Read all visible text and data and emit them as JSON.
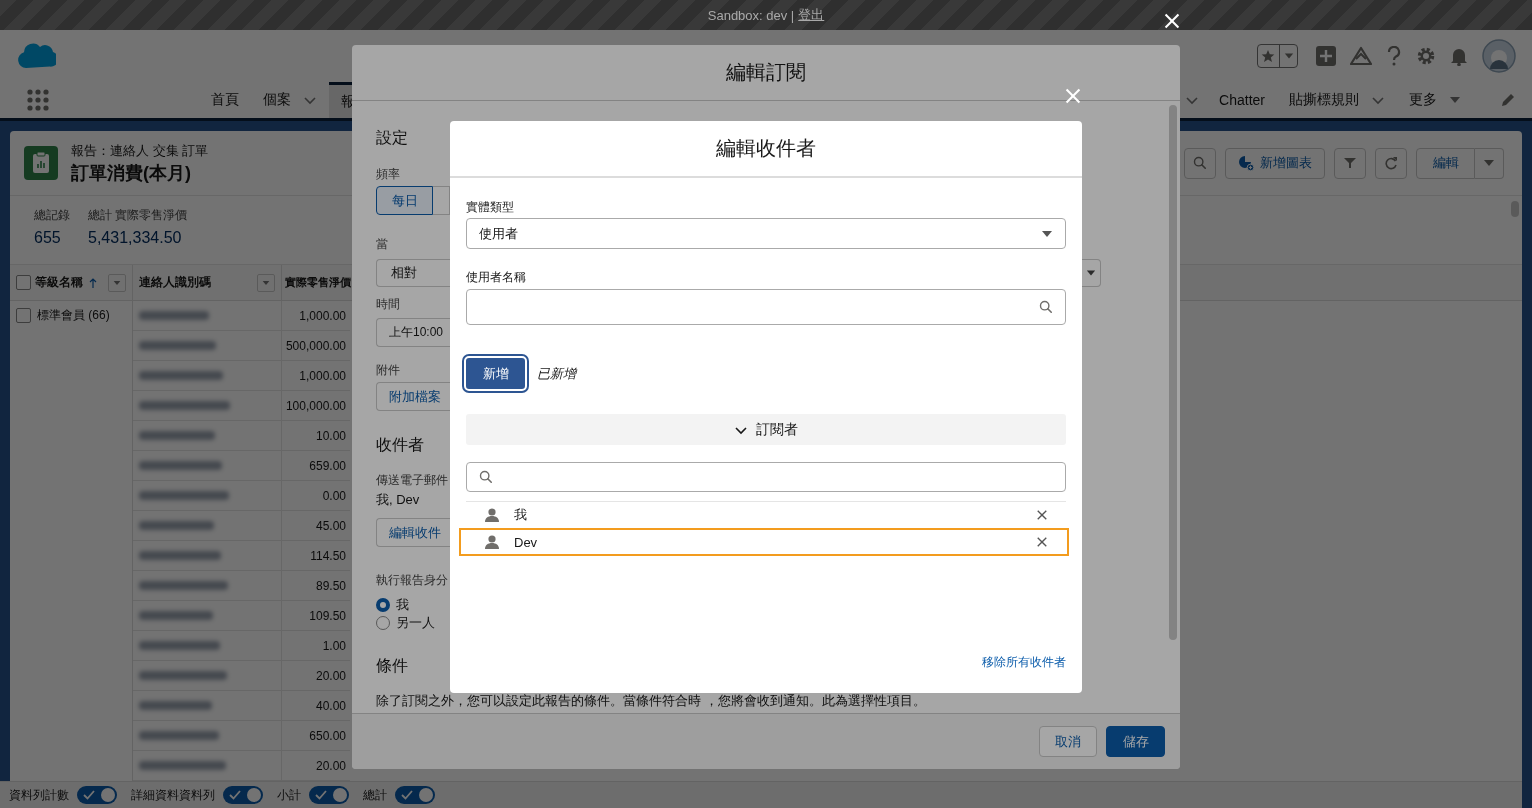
{
  "sandbox_banner": {
    "text": "Sandbox: dev |",
    "link": "登出"
  },
  "nav": {
    "tabs": [
      {
        "label": "首頁",
        "selected": false,
        "menu": false
      },
      {
        "label": "個案",
        "selected": false,
        "menu": true
      },
      {
        "label": "報",
        "selected": true,
        "menu": false
      }
    ],
    "right_items": [
      {
        "chevron_menu": true
      },
      {
        "label": "Chatter"
      },
      {
        "label": "貼撕標規則",
        "chevron_menu": true
      },
      {
        "label": "更多",
        "caret_menu": true
      }
    ]
  },
  "report": {
    "breadcrumb": "報告：連絡人 交集 訂單",
    "title": "訂單消費(本月)",
    "add_chart_button": "新增圖表",
    "edit_button": "編輯"
  },
  "summary": [
    {
      "label": "總記錄",
      "value": "655"
    },
    {
      "label": "總計 實際零售淨價",
      "value": "5,431,334.50"
    }
  ],
  "table": {
    "select_all_checked": false,
    "columns": [
      {
        "label": "等級名稱",
        "sorted_ascending": true,
        "filter_menu": true
      },
      {
        "label": "連絡人識別碼",
        "filter_menu": true
      },
      {
        "label": "實際零售淨價"
      }
    ],
    "groups": [
      {
        "label": "標準會員 (66)",
        "checked": false
      }
    ],
    "rows": [
      {
        "amount": "1,000.00"
      },
      {
        "amount": "500,000.00"
      },
      {
        "amount": "1,000.00"
      },
      {
        "amount": "100,000.00"
      },
      {
        "amount": "10.00"
      },
      {
        "amount": "659.00"
      },
      {
        "amount": "0.00"
      },
      {
        "amount": "45.00"
      },
      {
        "amount": "114.50"
      },
      {
        "amount": "89.50"
      },
      {
        "amount": "109.50"
      },
      {
        "amount": "1.00"
      },
      {
        "amount": "20.00"
      },
      {
        "amount": "40.00"
      },
      {
        "amount": "650.00"
      },
      {
        "amount": "20.00"
      }
    ]
  },
  "toggles": [
    {
      "label": "資料列計數",
      "on": true
    },
    {
      "label": "詳細資料資料列",
      "on": true
    },
    {
      "label": "小計",
      "on": true
    },
    {
      "label": "總計",
      "on": true
    }
  ],
  "subscription_modal": {
    "title": "編輯訂閱",
    "settings_heading": "設定",
    "frequency": {
      "label": "頻率",
      "options": [
        {
          "label": "每日",
          "selected": true
        }
      ]
    },
    "when": {
      "label": "當",
      "value": "相對"
    },
    "time": {
      "label": "時間",
      "value": "上午10:00"
    },
    "attachment": {
      "label": "附件",
      "button": "附加檔案"
    },
    "recipients_heading": "收件者",
    "send_to_label": "傳送電子郵件",
    "recipients": "我, Dev",
    "edit_recipients_button": "編輯收件",
    "run_as": {
      "label": "執行報告身分",
      "options": [
        {
          "label": "我",
          "selected": true
        },
        {
          "label": "另一人",
          "selected": false
        }
      ]
    },
    "conditions_heading": "條件",
    "conditions_text": "除了訂閱之外，您可以設定此報告的條件。當條件符合時 ，您將會收到通知。此為選擇性項目。",
    "buttons": [
      {
        "label": "取消",
        "kind": "neutral"
      },
      {
        "label": "儲存",
        "kind": "brand"
      }
    ]
  },
  "recipients_modal": {
    "title": "編輯收件者",
    "entity_type": {
      "label": "實體類型",
      "value": "使用者"
    },
    "user_name": {
      "label": "使用者名稱"
    },
    "add_button": "新增",
    "added_status": "已新增",
    "section": {
      "label": "訂閱者",
      "expanded": true
    },
    "subscribers": [
      {
        "name": "我",
        "selected": false
      },
      {
        "name": "Dev",
        "selected": true
      }
    ],
    "remove_all_link": "移除所有收件者"
  }
}
